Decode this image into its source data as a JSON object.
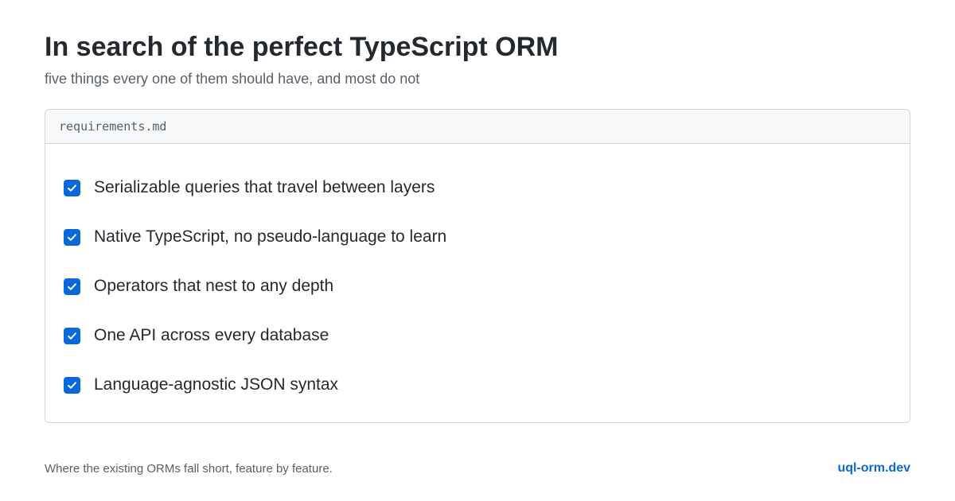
{
  "header": {
    "title": "In search of the perfect TypeScript ORM",
    "subtitle": "five things every one of them should have, and most do not"
  },
  "card": {
    "filename": "requirements.md",
    "items": [
      {
        "label": "Serializable queries that travel between layers",
        "checked": true,
        "icon": "checkmark-icon"
      },
      {
        "label": "Native TypeScript, no pseudo-language to learn",
        "checked": true,
        "icon": "checkmark-icon"
      },
      {
        "label": "Operators that nest to any depth",
        "checked": true,
        "icon": "checkmark-icon"
      },
      {
        "label": "One API across every database",
        "checked": true,
        "icon": "checkmark-icon"
      },
      {
        "label": "Language-agnostic JSON syntax",
        "checked": true,
        "icon": "checkmark-icon"
      }
    ]
  },
  "footer": {
    "text": "Where the existing ORMs fall short, feature by feature.",
    "link": "uql-orm.dev"
  },
  "colors": {
    "accent": "#0969da",
    "text": "#24292f",
    "muted": "#57606a",
    "border": "#d0d7de",
    "header_bg": "#f6f8fa"
  }
}
